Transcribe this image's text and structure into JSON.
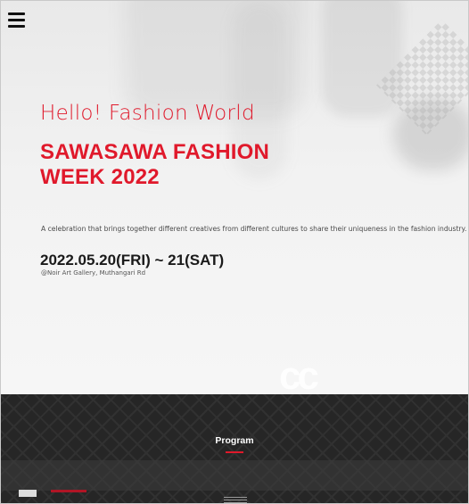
{
  "nav": {
    "menu_icon": "hamburger-menu-icon"
  },
  "hero": {
    "greeting": "Hello! Fashion World",
    "title": "SAWASAWA FASHION WEEK 2022",
    "description": "A celebration that brings together different creatives from different cultures to share their uniqueness in the fashion industry.",
    "date": "2022.05.20(FRI) ~ 21(SAT)",
    "venue": "@Noir Art Gallery, Muthangari Rd"
  },
  "program": {
    "label": "Program"
  },
  "colors": {
    "accent": "#e0192b",
    "dark_band": "#262626",
    "text_dark": "#1a1a1a"
  }
}
